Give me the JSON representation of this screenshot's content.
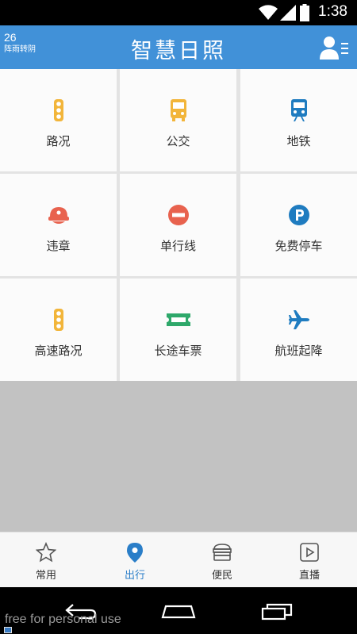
{
  "status_bar": {
    "time": "1:38"
  },
  "header": {
    "title": "智慧日照",
    "weather_temp": "26",
    "weather_desc": "阵雨转阴"
  },
  "grid": {
    "items": [
      {
        "label": "路况",
        "icon": "traffic-light-icon",
        "color": "#f2b53a"
      },
      {
        "label": "公交",
        "icon": "bus-icon",
        "color": "#f2b53a"
      },
      {
        "label": "地铁",
        "icon": "subway-icon",
        "color": "#1f7cc0"
      },
      {
        "label": "违章",
        "icon": "police-cap-icon",
        "color": "#e8624e"
      },
      {
        "label": "单行线",
        "icon": "no-entry-icon",
        "color": "#e8624e"
      },
      {
        "label": "免费停车",
        "icon": "parking-icon",
        "color": "#1f7cc0"
      },
      {
        "label": "高速路况",
        "icon": "traffic-light-icon",
        "color": "#f2b53a"
      },
      {
        "label": "长途车票",
        "icon": "ticket-icon",
        "color": "#2ea86a"
      },
      {
        "label": "航班起降",
        "icon": "airplane-icon",
        "color": "#1f7cc0"
      }
    ]
  },
  "tabs": [
    {
      "label": "常用",
      "icon": "star-icon",
      "active": false
    },
    {
      "label": "出行",
      "icon": "location-pin-icon",
      "active": true
    },
    {
      "label": "便民",
      "icon": "store-icon",
      "active": false
    },
    {
      "label": "直播",
      "icon": "play-icon",
      "active": false
    }
  ],
  "watermark": "free for personal use",
  "colors": {
    "header": "#4191d8",
    "accent": "#2a7ec8"
  }
}
